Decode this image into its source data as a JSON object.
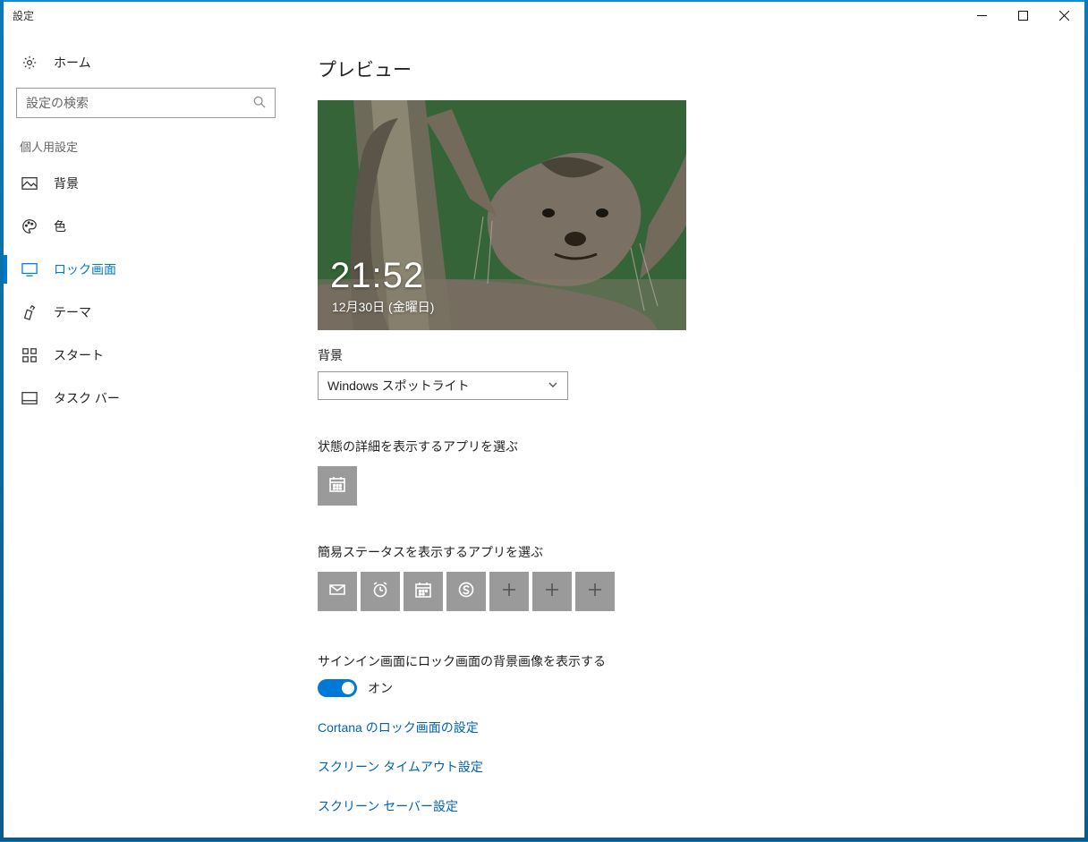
{
  "window": {
    "title": "設定"
  },
  "sidebar": {
    "home": "ホーム",
    "search_placeholder": "設定の検索",
    "section": "個人用設定",
    "items": [
      {
        "label": "背景"
      },
      {
        "label": "色"
      },
      {
        "label": "ロック画面"
      },
      {
        "label": "テーマ"
      },
      {
        "label": "スタート"
      },
      {
        "label": "タスク バー"
      }
    ]
  },
  "main": {
    "heading": "プレビュー",
    "preview": {
      "time": "21:52",
      "date": "12月30日 (金曜日)"
    },
    "bg_label": "背景",
    "bg_value": "Windows スポットライト",
    "detailed_label": "状態の詳細を表示するアプリを選ぶ",
    "quick_label": "簡易ステータスを表示するアプリを選ぶ",
    "signin_bg_label": "サインイン画面にロック画面の背景画像を表示する",
    "toggle_state": "オン",
    "links": [
      "Cortana のロック画面の設定",
      "スクリーン タイムアウト設定",
      "スクリーン セーバー設定"
    ]
  }
}
